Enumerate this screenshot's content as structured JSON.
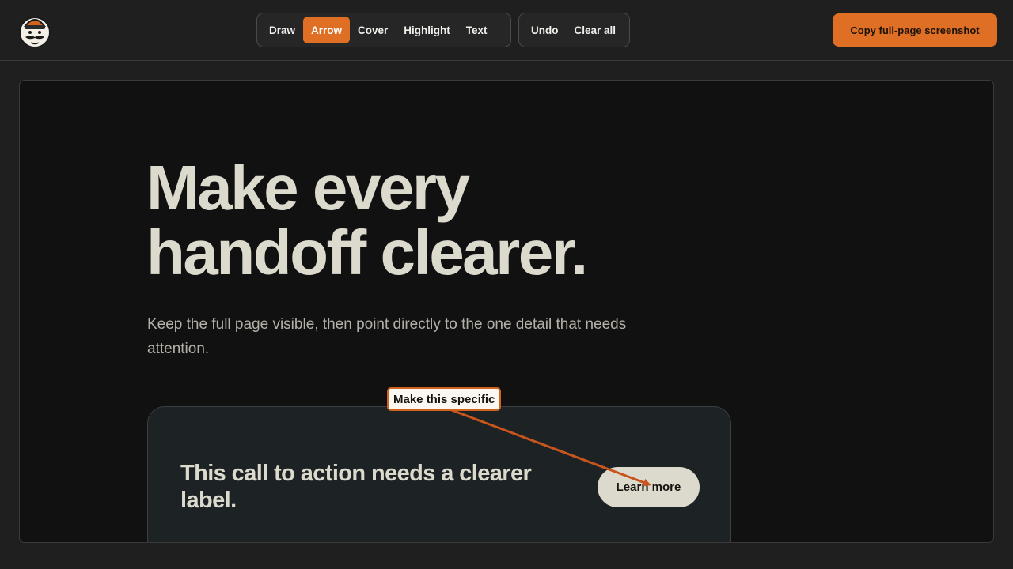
{
  "toolbar": {
    "tools": [
      {
        "label": "Draw",
        "active": false
      },
      {
        "label": "Arrow",
        "active": true
      },
      {
        "label": "Cover",
        "active": false
      },
      {
        "label": "Highlight",
        "active": false
      },
      {
        "label": "Text",
        "active": false
      }
    ],
    "history": [
      {
        "label": "Undo"
      },
      {
        "label": "Clear all"
      }
    ],
    "copy_label": "Copy full-page screenshot"
  },
  "page": {
    "headline_line1": "Make every",
    "headline_line2": "handoff clearer.",
    "subtitle": "Keep the full page visible, then point directly to the one detail that needs attention.",
    "card_title": "This call to action needs a clearer label.",
    "cta_label": "Learn more"
  },
  "annotation": {
    "note_text": "Make this specific",
    "color": "#c9551e"
  },
  "colors": {
    "accent": "#df6f24",
    "background": "#1f1f20",
    "canvas": "#101110",
    "text": "#dcd9cd"
  },
  "icons": {
    "logo": "mustache-chef-mascot-icon"
  }
}
